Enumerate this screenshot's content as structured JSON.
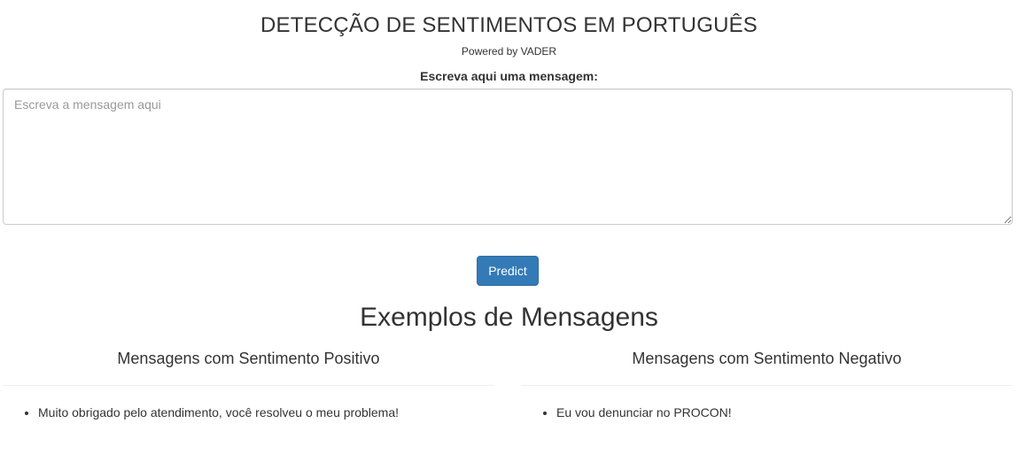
{
  "header": {
    "title": "DETECÇÃO DE SENTIMENTOS EM PORTUGUÊS",
    "subtitle": "Powered by VADER"
  },
  "form": {
    "label": "Escreva aqui uma mensagem:",
    "message_value": "",
    "message_placeholder": "Escreva a mensagem aqui",
    "predict_label": "Predict"
  },
  "examples": {
    "title": "Exemplos de Mensagens",
    "positive": {
      "heading": "Mensagens com Sentimento Positivo",
      "items": [
        "Muito obrigado pelo atendimento, você resolveu o meu problema!"
      ]
    },
    "negative": {
      "heading": "Mensagens com Sentimento Negativo",
      "items": [
        "Eu vou denunciar no PROCON!"
      ]
    }
  },
  "colors": {
    "button_background": "#337ab7",
    "button_border": "#2e6da4",
    "text": "#333333",
    "input_border": "#cccccc",
    "divider": "#eeeeee"
  }
}
